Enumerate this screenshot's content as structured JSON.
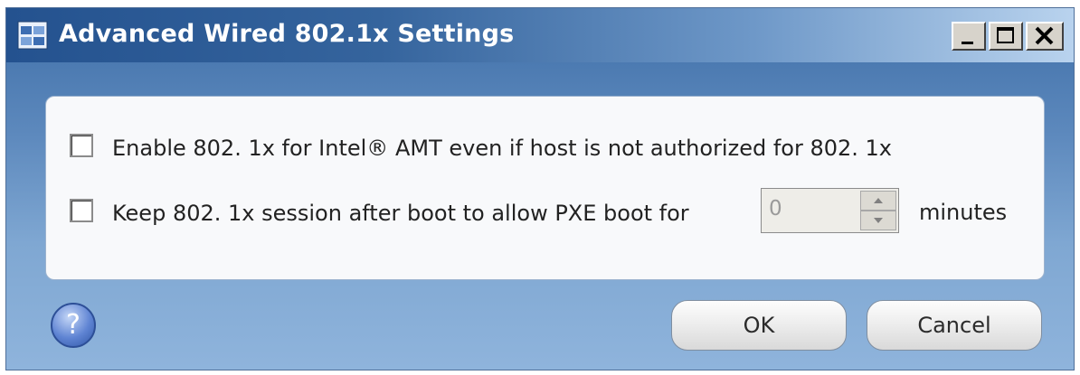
{
  "window": {
    "title": "Advanced Wired 802.1x Settings"
  },
  "options": {
    "enable_label": "Enable 802. 1x for Intel® AMT even if host is not authorized for 802. 1x",
    "keep_label": "Keep 802. 1x session after boot to allow PXE boot for",
    "enable_checked": false,
    "keep_checked": false,
    "minutes_value": "0",
    "minutes_unit": "minutes"
  },
  "buttons": {
    "help": "?",
    "ok": "OK",
    "cancel": "Cancel"
  }
}
